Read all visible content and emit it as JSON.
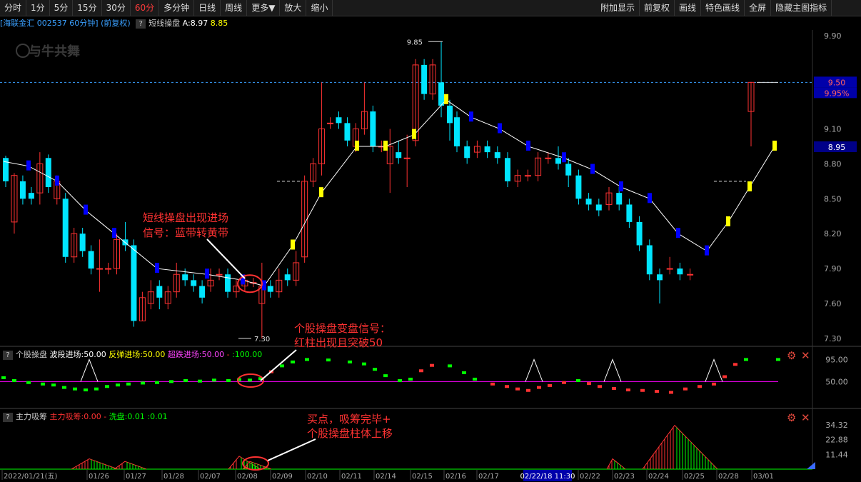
{
  "toolbar": {
    "left": [
      "分时",
      "1分",
      "5分",
      "15分",
      "30分",
      "60分",
      "多分钟",
      "日线",
      "周线",
      "更多▼",
      "放大",
      "缩小"
    ],
    "active": "60分",
    "right": [
      "附加显示",
      "前复权",
      "画线",
      "特色画线",
      "全屏",
      "隐藏主图指标"
    ]
  },
  "header": {
    "stock": "[海联金汇",
    "code": "002537 60分钟]",
    "adj": "(前复权)",
    "indicator": "短线操盘",
    "a_label": "A:8.97",
    "b_label": "8.85",
    "watermark": "与牛共舞"
  },
  "price_axis": {
    "ticks": [
      "9.90",
      "9.10",
      "8.80",
      "8.50",
      "8.20",
      "7.90",
      "7.60",
      "7.30"
    ],
    "hi_label": "9.85",
    "lo_label": "7.30",
    "cur_price": "9.50",
    "cur_pct": "9.95%",
    "line_price": "8.95"
  },
  "panel2": {
    "name": "个股操盘",
    "items": [
      "波段进场:50.00",
      "反弹进场:50.00",
      "超跌进场:50.00",
      "-",
      ":100.00"
    ],
    "ticks": [
      "95.00",
      "50.00"
    ]
  },
  "panel3": {
    "name": "主力吸筹",
    "items": [
      "主力吸筹:0.00",
      "-",
      "洗盘:0.01",
      ":0.01"
    ],
    "ticks": [
      "34.32",
      "22.88",
      "11.44"
    ]
  },
  "annotations": {
    "a1_line1": "短线操盘出现进场",
    "a1_line2": "信号：蓝带转黄带",
    "a2_line1": "个股操盘变盘信号：",
    "a2_line2": "红柱出现且突破50",
    "a3_line1": "买点，吸筹完毕+",
    "a3_line2": "个股操盘柱体上移"
  },
  "dates": [
    "2022/01/21(五)",
    "01/26",
    "01/27",
    "01/28",
    "02/07",
    "02/08",
    "02/09",
    "02/10",
    "02/11",
    "02/14",
    "02/15",
    "02/16",
    "02/17",
    "02/18",
    "02/22/18 11:30",
    "02/22",
    "02/23",
    "02/24",
    "02/25",
    "02/28",
    "03/01"
  ],
  "colors": {
    "up": "#ff3232",
    "down": "#00e5ff",
    "yellow": "#ffff00",
    "blue": "#0000ff",
    "green": "#00ff00",
    "magenta": "#ff00ff"
  },
  "chart_data": {
    "type": "candlestick",
    "ylim": [
      7.25,
      9.95
    ],
    "candles": [
      {
        "o": 8.85,
        "c": 8.65,
        "h": 8.87,
        "l": 8.6
      },
      {
        "o": 8.3,
        "c": 8.7,
        "h": 8.72,
        "l": 8.2
      },
      {
        "o": 8.65,
        "c": 8.5,
        "h": 8.7,
        "l": 8.45
      },
      {
        "o": 8.55,
        "c": 8.5,
        "h": 8.6,
        "l": 8.45
      },
      {
        "o": 8.55,
        "c": 8.8,
        "h": 8.9,
        "l": 8.45
      },
      {
        "o": 8.85,
        "c": 8.6,
        "h": 8.88,
        "l": 8.55
      },
      {
        "o": 8.5,
        "c": 8.65,
        "h": 8.7,
        "l": 8.45
      },
      {
        "o": 8.5,
        "c": 8.0,
        "h": 8.55,
        "l": 7.95
      },
      {
        "o": 8.0,
        "c": 8.2,
        "h": 8.25,
        "l": 7.95
      },
      {
        "o": 8.2,
        "c": 8.05,
        "h": 8.25,
        "l": 8.0
      },
      {
        "o": 8.05,
        "c": 7.9,
        "h": 8.1,
        "l": 7.85
      },
      {
        "o": 7.9,
        "c": 7.9,
        "h": 8.15,
        "l": 7.7
      },
      {
        "o": 7.9,
        "c": 7.9,
        "h": 7.95,
        "l": 7.85
      },
      {
        "o": 7.9,
        "c": 8.15,
        "h": 8.2,
        "l": 7.85
      },
      {
        "o": 8.15,
        "c": 8.1,
        "h": 8.3,
        "l": 8.05
      },
      {
        "o": 8.1,
        "c": 7.45,
        "h": 8.15,
        "l": 7.4
      },
      {
        "o": 7.45,
        "c": 7.65,
        "h": 7.7,
        "l": 7.45
      },
      {
        "o": 7.6,
        "c": 7.7,
        "h": 7.8,
        "l": 7.55
      },
      {
        "o": 7.75,
        "c": 7.65,
        "h": 7.8,
        "l": 7.55
      },
      {
        "o": 7.6,
        "c": 7.7,
        "h": 7.75,
        "l": 7.55
      },
      {
        "o": 7.7,
        "c": 7.85,
        "h": 7.95,
        "l": 7.65
      },
      {
        "o": 7.85,
        "c": 7.8,
        "h": 7.9,
        "l": 7.75
      },
      {
        "o": 7.8,
        "c": 7.75,
        "h": 7.85,
        "l": 7.7
      },
      {
        "o": 7.75,
        "c": 7.65,
        "h": 7.8,
        "l": 7.6
      },
      {
        "o": 7.75,
        "c": 7.8,
        "h": 7.9,
        "l": 7.7
      },
      {
        "o": 7.85,
        "c": 7.85,
        "h": 7.9,
        "l": 7.8
      },
      {
        "o": 7.85,
        "c": 7.7,
        "h": 7.9,
        "l": 7.65
      },
      {
        "o": 7.7,
        "c": 7.75,
        "h": 7.8,
        "l": 7.65
      },
      {
        "o": 7.75,
        "c": 7.8,
        "h": 7.85,
        "l": 7.7
      },
      {
        "o": 7.78,
        "c": 7.78,
        "h": 7.82,
        "l": 7.74
      },
      {
        "o": 7.6,
        "c": 7.75,
        "h": 7.95,
        "l": 7.3
      },
      {
        "o": 7.75,
        "c": 7.7,
        "h": 7.8,
        "l": 7.65
      },
      {
        "o": 7.7,
        "c": 7.8,
        "h": 7.9,
        "l": 7.65
      },
      {
        "o": 7.85,
        "c": 7.8,
        "h": 7.9,
        "l": 7.75
      },
      {
        "o": 7.8,
        "c": 7.95,
        "h": 8.05,
        "l": 7.75
      },
      {
        "o": 8.0,
        "c": 8.65,
        "h": 8.7,
        "l": 7.95
      }
    ],
    "line_pct": [
      {
        "o": 8.65,
        "c": 8.8,
        "h": 8.85,
        "l": 8.6
      },
      {
        "o": 8.8,
        "c": 9.1,
        "h": 9.5,
        "l": 8.7
      },
      {
        "o": 9.15,
        "c": 9.15,
        "h": 9.2,
        "l": 9.1
      },
      {
        "o": 9.2,
        "c": 9.15,
        "h": 9.25,
        "l": 9.1
      },
      {
        "o": 9.15,
        "c": 9.0,
        "h": 9.2,
        "l": 8.95
      },
      {
        "o": 8.95,
        "c": 9.1,
        "h": 9.15,
        "l": 8.9
      },
      {
        "o": 9.1,
        "c": 9.25,
        "h": 9.5,
        "l": 9.05
      },
      {
        "o": 9.25,
        "c": 8.95,
        "h": 9.3,
        "l": 8.9
      },
      {
        "o": 8.95,
        "c": 8.95,
        "h": 9.0,
        "l": 8.9
      },
      {
        "o": 8.8,
        "c": 8.95,
        "h": 9.1,
        "l": 8.55
      },
      {
        "o": 8.9,
        "c": 8.85,
        "h": 9.0,
        "l": 8.8
      },
      {
        "o": 8.85,
        "c": 8.85,
        "h": 9.05,
        "l": 8.6
      },
      {
        "o": 9.0,
        "c": 9.65,
        "h": 9.7,
        "l": 8.95
      },
      {
        "o": 9.65,
        "c": 9.4,
        "h": 9.7,
        "l": 9.35
      },
      {
        "o": 9.4,
        "c": 9.65,
        "h": 9.7,
        "l": 9.35
      },
      {
        "o": 9.5,
        "c": 9.3,
        "h": 9.85,
        "l": 9.2
      },
      {
        "o": 9.3,
        "c": 9.15,
        "h": 9.35,
        "l": 9.0
      }
    ]
  }
}
